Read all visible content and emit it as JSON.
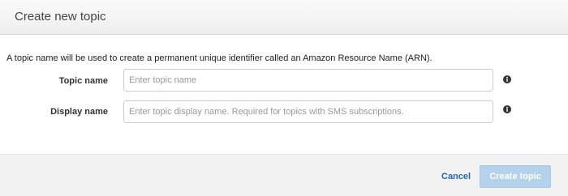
{
  "dialog": {
    "title": "Create new topic",
    "intro": "A topic name will be used to create a permanent unique identifier called an Amazon Resource Name (ARN)."
  },
  "form": {
    "topic_name": {
      "label": "Topic name",
      "value": "",
      "placeholder": "Enter topic name",
      "info_icon": "info-circle"
    },
    "display_name": {
      "label": "Display name",
      "value": "",
      "placeholder": "Enter topic display name. Required for topics with SMS subscriptions.",
      "info_icon": "info-circle"
    }
  },
  "footer": {
    "cancel_label": "Cancel",
    "create_label": "Create topic",
    "create_enabled": false
  },
  "colors": {
    "link": "#1f66b3",
    "primary_disabled": "#b5d2ec",
    "header_bg": "#f0f0f0",
    "footer_bg": "#f2f2f2"
  }
}
